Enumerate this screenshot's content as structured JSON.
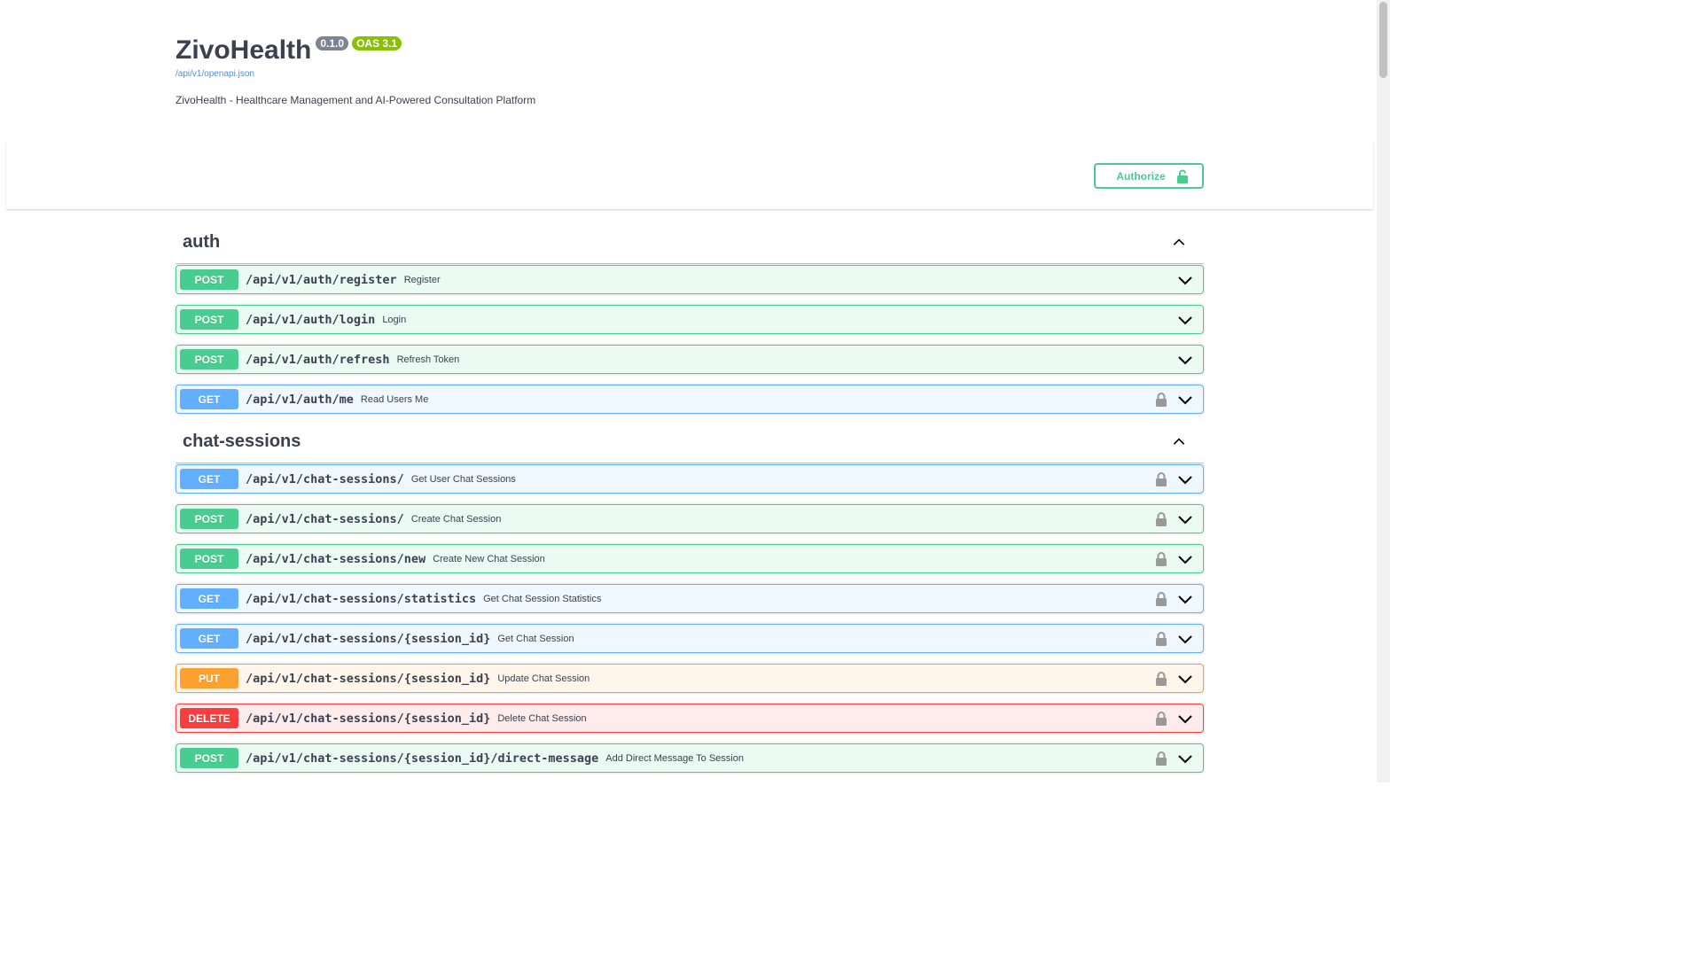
{
  "info": {
    "title": "ZivoHealth",
    "version": "0.1.0",
    "oas": "OAS 3.1",
    "spec_url": "/api/v1/openapi.json",
    "description": "ZivoHealth - Healthcare Management and AI-Powered Consultation Platform"
  },
  "authorize": {
    "label": "Authorize"
  },
  "colors": {
    "post": "#49cc90",
    "get": "#61affe",
    "put": "#fca130",
    "delete": "#f93e3e"
  },
  "tags": [
    {
      "name": "auth",
      "operations": [
        {
          "method": "POST",
          "path": "/api/v1/auth/register",
          "summary": "Register",
          "locked": false
        },
        {
          "method": "POST",
          "path": "/api/v1/auth/login",
          "summary": "Login",
          "locked": false
        },
        {
          "method": "POST",
          "path": "/api/v1/auth/refresh",
          "summary": "Refresh Token",
          "locked": false
        },
        {
          "method": "GET",
          "path": "/api/v1/auth/me",
          "summary": "Read Users Me",
          "locked": true
        }
      ]
    },
    {
      "name": "chat-sessions",
      "operations": [
        {
          "method": "GET",
          "path": "/api/v1/chat-sessions/",
          "summary": "Get User Chat Sessions",
          "locked": true
        },
        {
          "method": "POST",
          "path": "/api/v1/chat-sessions/",
          "summary": "Create Chat Session",
          "locked": true
        },
        {
          "method": "POST",
          "path": "/api/v1/chat-sessions/new",
          "summary": "Create New Chat Session",
          "locked": true
        },
        {
          "method": "GET",
          "path": "/api/v1/chat-sessions/statistics",
          "summary": "Get Chat Session Statistics",
          "locked": true
        },
        {
          "method": "GET",
          "path": "/api/v1/chat-sessions/{session_id}",
          "summary": "Get Chat Session",
          "locked": true
        },
        {
          "method": "PUT",
          "path": "/api/v1/chat-sessions/{session_id}",
          "summary": "Update Chat Session",
          "locked": true
        },
        {
          "method": "DELETE",
          "path": "/api/v1/chat-sessions/{session_id}",
          "summary": "Delete Chat Session",
          "locked": true
        },
        {
          "method": "POST",
          "path": "/api/v1/chat-sessions/{session_id}/direct-message",
          "summary": "Add Direct Message To Session",
          "locked": true
        }
      ]
    }
  ]
}
